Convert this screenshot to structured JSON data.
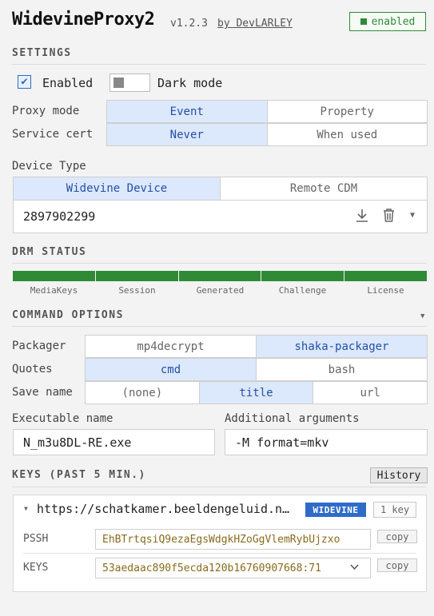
{
  "header": {
    "title": "WidevineProxy2",
    "version": "v1.2.3",
    "author": "by DevLARLEY",
    "status_badge": "enabled"
  },
  "settings": {
    "heading": "SETTINGS",
    "enabled_label": "Enabled",
    "enabled_checked": true,
    "dark_mode_label": "Dark mode",
    "dark_mode_on": false,
    "proxy_mode": {
      "label": "Proxy mode",
      "options": [
        "Event",
        "Property"
      ],
      "selected": "Event"
    },
    "service_cert": {
      "label": "Service cert",
      "options": [
        "Never",
        "When used"
      ],
      "selected": "Never"
    },
    "device_type": {
      "label": "Device Type",
      "options": [
        "Widevine Device",
        "Remote CDM"
      ],
      "selected": "Widevine Device"
    },
    "device_value": "2897902299"
  },
  "drm_status": {
    "heading": "DRM STATUS",
    "steps": [
      "MediaKeys",
      "Session",
      "Generated",
      "Challenge",
      "License"
    ],
    "color": "#2f8a36"
  },
  "command_options": {
    "heading": "COMMAND OPTIONS",
    "packager": {
      "label": "Packager",
      "options": [
        "mp4decrypt",
        "shaka-packager"
      ],
      "selected": "shaka-packager"
    },
    "quotes": {
      "label": "Quotes",
      "options": [
        "cmd",
        "bash"
      ],
      "selected": "cmd"
    },
    "save_name": {
      "label": "Save name",
      "options": [
        "(none)",
        "title",
        "url"
      ],
      "selected": "title"
    },
    "executable_name_label": "Executable name",
    "executable_name_value": "N_m3u8DL-RE.exe",
    "additional_args_label": "Additional arguments",
    "additional_args_value": "-M format=mkv"
  },
  "keys": {
    "heading": "KEYS (PAST 5 MIN.)",
    "history_label": "History",
    "entry": {
      "url": "https://schatkamer.beeldengeluid.n…",
      "system_tag": "WIDEVINE",
      "key_count": "1 key",
      "pssh_label": "PSSH",
      "pssh_value": "EhBTrtqsiQ9ezaEgsWdgkHZoGgVlemRybUjzxo",
      "keys_label": "KEYS",
      "keys_value": "53aedaac890f5ecda120b16760907668:71",
      "copy_label": "copy"
    }
  },
  "colors": {
    "accent": "#2f6cc9",
    "selected_bg": "#dce8fb",
    "enabled_green": "#2e8b3a"
  }
}
